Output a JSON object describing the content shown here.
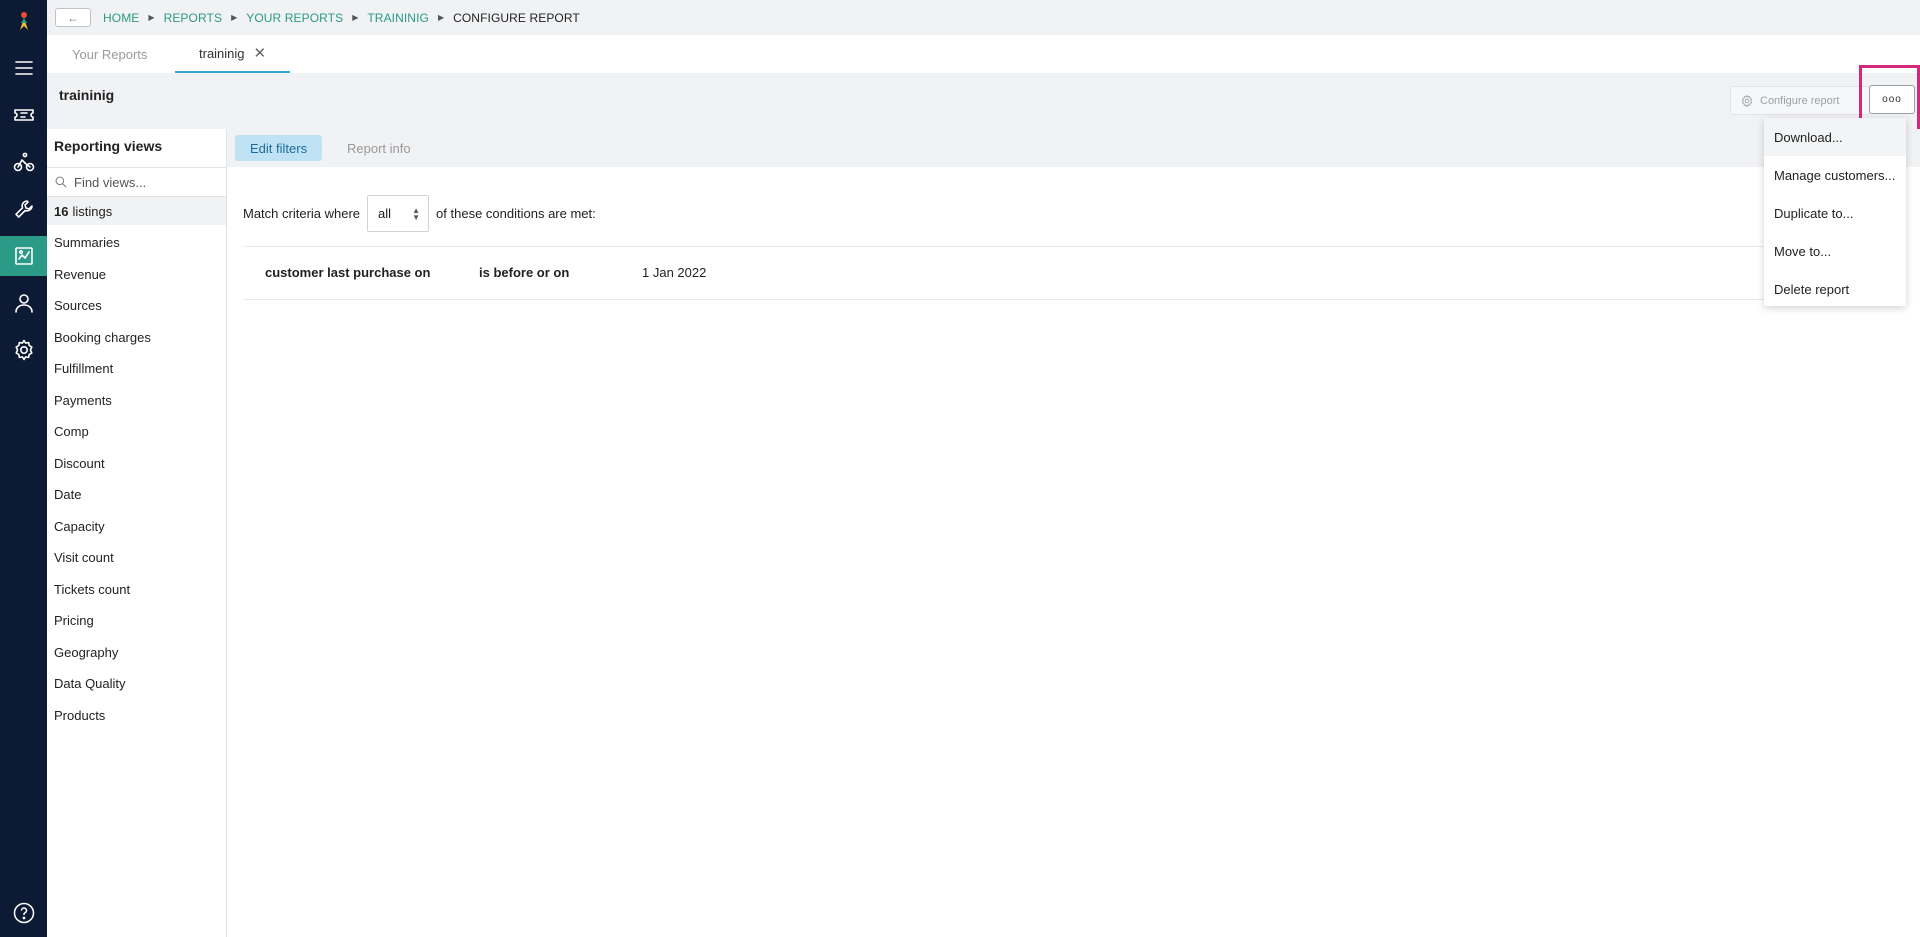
{
  "breadcrumb": {
    "back_icon": "arrow-left-icon",
    "items": [
      "HOME",
      "REPORTS",
      "YOUR REPORTS",
      "TRAININIG",
      "CONFIGURE REPORT"
    ]
  },
  "tabs": [
    {
      "label": "Your Reports"
    },
    {
      "label": "traininig"
    }
  ],
  "report": {
    "title": "traininig",
    "configure_label": "Configure report",
    "more_label": "ooo"
  },
  "views": {
    "title": "Reporting views",
    "search_placeholder": "Find views...",
    "count": "16",
    "count_label": "listings",
    "items": [
      "Summaries",
      "Revenue",
      "Sources",
      "Booking charges",
      "Fulfillment",
      "Payments",
      "Comp",
      "Discount",
      "Date",
      "Capacity",
      "Visit count",
      "Tickets count",
      "Pricing",
      "Geography",
      "Data Quality",
      "Products"
    ]
  },
  "subtabs": [
    "Edit filters",
    "Report info"
  ],
  "criteria": {
    "prefix": "Match criteria where",
    "selected": "all",
    "suffix": "of these conditions are met:"
  },
  "condition": {
    "field": "customer last purchase on",
    "operator": "is before or on",
    "value": "1 Jan 2022"
  },
  "menu": [
    "Download...",
    "Manage customers...",
    "Duplicate to...",
    "Move to...",
    "Delete report"
  ],
  "colors": {
    "rail": "#0d1a33",
    "accent": "#2b9a86",
    "highlight": "#d6287a",
    "active_subtab": "#bfe3f5"
  }
}
